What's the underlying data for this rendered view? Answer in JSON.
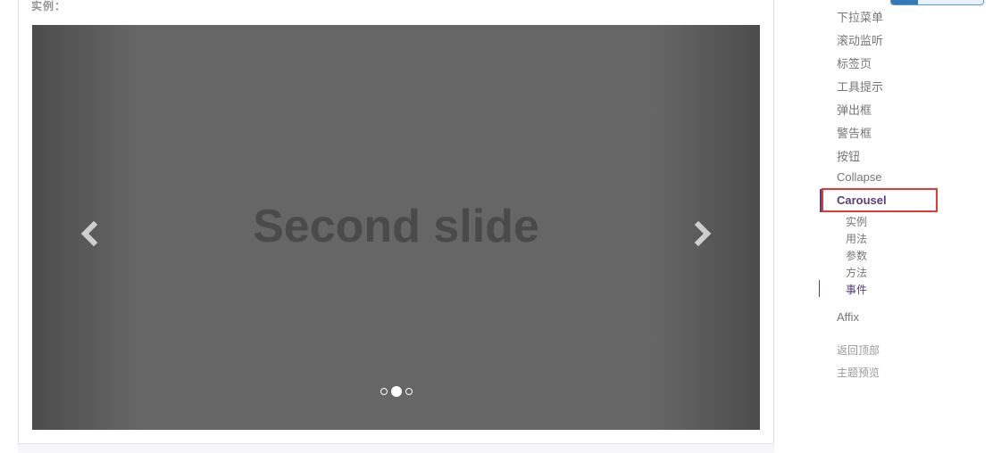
{
  "section": {
    "example_label": "实例："
  },
  "carousel": {
    "slide_caption": "Second slide",
    "prev_icon": "chevron-left-icon",
    "next_icon": "chevron-right-icon",
    "indicators": [
      {
        "active": false
      },
      {
        "active": true
      },
      {
        "active": false
      }
    ],
    "active_index": 2,
    "total_slides": 3
  },
  "sidenav": {
    "items": [
      {
        "label": "下拉菜单"
      },
      {
        "label": "滚动监听"
      },
      {
        "label": "标签页"
      },
      {
        "label": "工具提示"
      },
      {
        "label": "弹出框"
      },
      {
        "label": "警告框"
      },
      {
        "label": "按钮"
      },
      {
        "label": "Collapse"
      },
      {
        "label": "Carousel",
        "active": true
      },
      {
        "label": "Affix"
      }
    ],
    "subitems": [
      {
        "label": "实例"
      },
      {
        "label": "用法"
      },
      {
        "label": "参数"
      },
      {
        "label": "方法"
      },
      {
        "label": "事件",
        "active": true
      }
    ],
    "back_to_top": "返回顶部",
    "theme_preview": "主题预览"
  },
  "colors": {
    "accent": "#563d7c",
    "highlight_box": "#e53935",
    "carousel_bg": "#666666"
  }
}
